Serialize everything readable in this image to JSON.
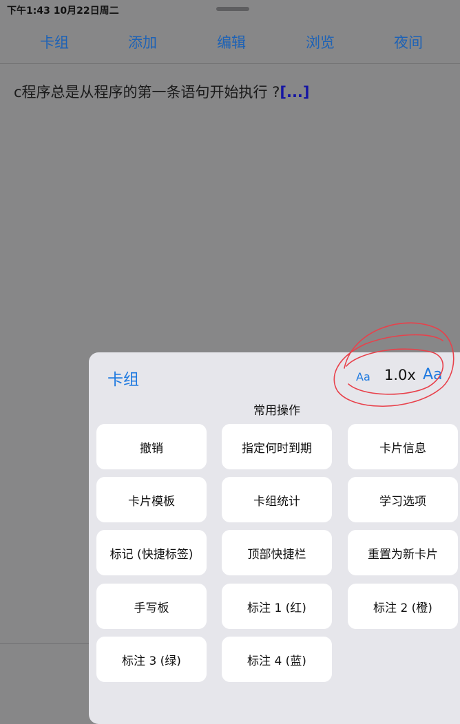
{
  "status_bar": {
    "time": "下午1:43   10月22日周二"
  },
  "top_nav": {
    "items": [
      {
        "label": "卡组"
      },
      {
        "label": "添加"
      },
      {
        "label": "编辑"
      },
      {
        "label": "浏览"
      },
      {
        "label": "夜间"
      }
    ]
  },
  "card": {
    "question": "c程序总是从程序的第一条语句开始执行 ?",
    "cloze": "[...]"
  },
  "sheet": {
    "title": "卡组",
    "font_small_label": "Aa",
    "zoom_level": "1.0x",
    "font_large_label": "Aa",
    "section_title": "常用操作",
    "actions": [
      {
        "label": "撤销"
      },
      {
        "label": "指定何时到期"
      },
      {
        "label": "卡片信息"
      },
      {
        "label": "卡片模板"
      },
      {
        "label": "卡组统计"
      },
      {
        "label": "学习选项"
      },
      {
        "label": "标记 (快捷标签)"
      },
      {
        "label": "顶部快捷栏"
      },
      {
        "label": "重置为新卡片"
      },
      {
        "label": "手写板"
      },
      {
        "label": "标注 1 (红)"
      },
      {
        "label": "标注 2 (橙)"
      },
      {
        "label": "标注 3 (绿)"
      },
      {
        "label": "标注 4 (蓝)"
      }
    ]
  },
  "colors": {
    "accent": "#1f7ae0",
    "nav_text": "#1d62b6",
    "dim_background": "#878788",
    "sheet_background": "#e6e6eb",
    "annotation": "#e8414b"
  }
}
